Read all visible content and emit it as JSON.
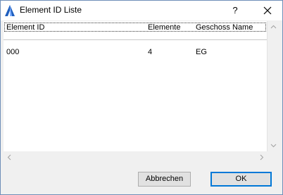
{
  "window": {
    "title": "Element ID Liste",
    "help_label": "?"
  },
  "icons": {
    "app": "archicad-app-icon",
    "close": "close-icon",
    "scroll_up": "chevron-up-icon",
    "scroll_down": "chevron-down-icon",
    "scroll_left": "chevron-left-icon",
    "scroll_right": "chevron-right-icon"
  },
  "table": {
    "columns": [
      "Element ID",
      "Elemente",
      "Geschoss Name"
    ],
    "rows": [
      [
        "000",
        "4",
        "EG"
      ]
    ]
  },
  "buttons": {
    "cancel_label": "Abbrechen",
    "ok_label": "OK"
  },
  "colors": {
    "accent": "#0078d7",
    "window_border": "#6f8fb8",
    "dialog_bg": "#f0f0f0",
    "button_bg": "#e1e1e1"
  }
}
